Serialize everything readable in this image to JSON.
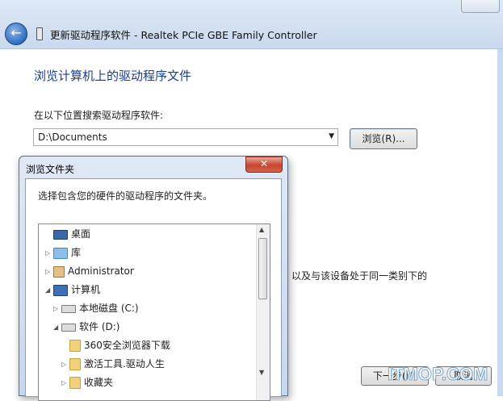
{
  "window": {
    "title": "更新驱动程序软件 - Realtek PCIe GBE Family Controller",
    "heading": "浏览计算机上的驱动程序文件",
    "search_label": "在以下位置搜索驱动程序软件:",
    "path_value": "D:\\Documents",
    "browse_button": "浏览(R)...",
    "partial_text": "以及与该设备处于同一类别下的",
    "next_button": "下一步(N)",
    "cancel_button": "取消"
  },
  "watermark": "ITMOP.COM",
  "dialog": {
    "title": "浏览文件夹",
    "close_glyph": "✕",
    "prompt": "选择包含您的硬件的驱动程序的文件夹。",
    "tree": [
      {
        "label": "桌面",
        "icon": "desktop-icon",
        "expander": ""
      },
      {
        "label": "库",
        "icon": "library-icon",
        "expander": "▷"
      },
      {
        "label": "Administrator",
        "icon": "user-folder-icon",
        "expander": "▷"
      },
      {
        "label": "计算机",
        "icon": "computer-icon",
        "expander": "◢"
      },
      {
        "label": "本地磁盘 (C:)",
        "icon": "drive-icon",
        "expander": "▷"
      },
      {
        "label": "软件 (D:)",
        "icon": "drive-icon",
        "expander": "◢"
      },
      {
        "label": "360安全浏览器下载",
        "icon": "folder-icon",
        "expander": ""
      },
      {
        "label": "激活工具.驱动人生",
        "icon": "folder-icon",
        "expander": "▷"
      },
      {
        "label": "收藏夹",
        "icon": "folder-icon",
        "expander": "▷"
      }
    ]
  },
  "colors": {
    "heading": "#1a3e8c",
    "close_button": "#c8442e"
  }
}
